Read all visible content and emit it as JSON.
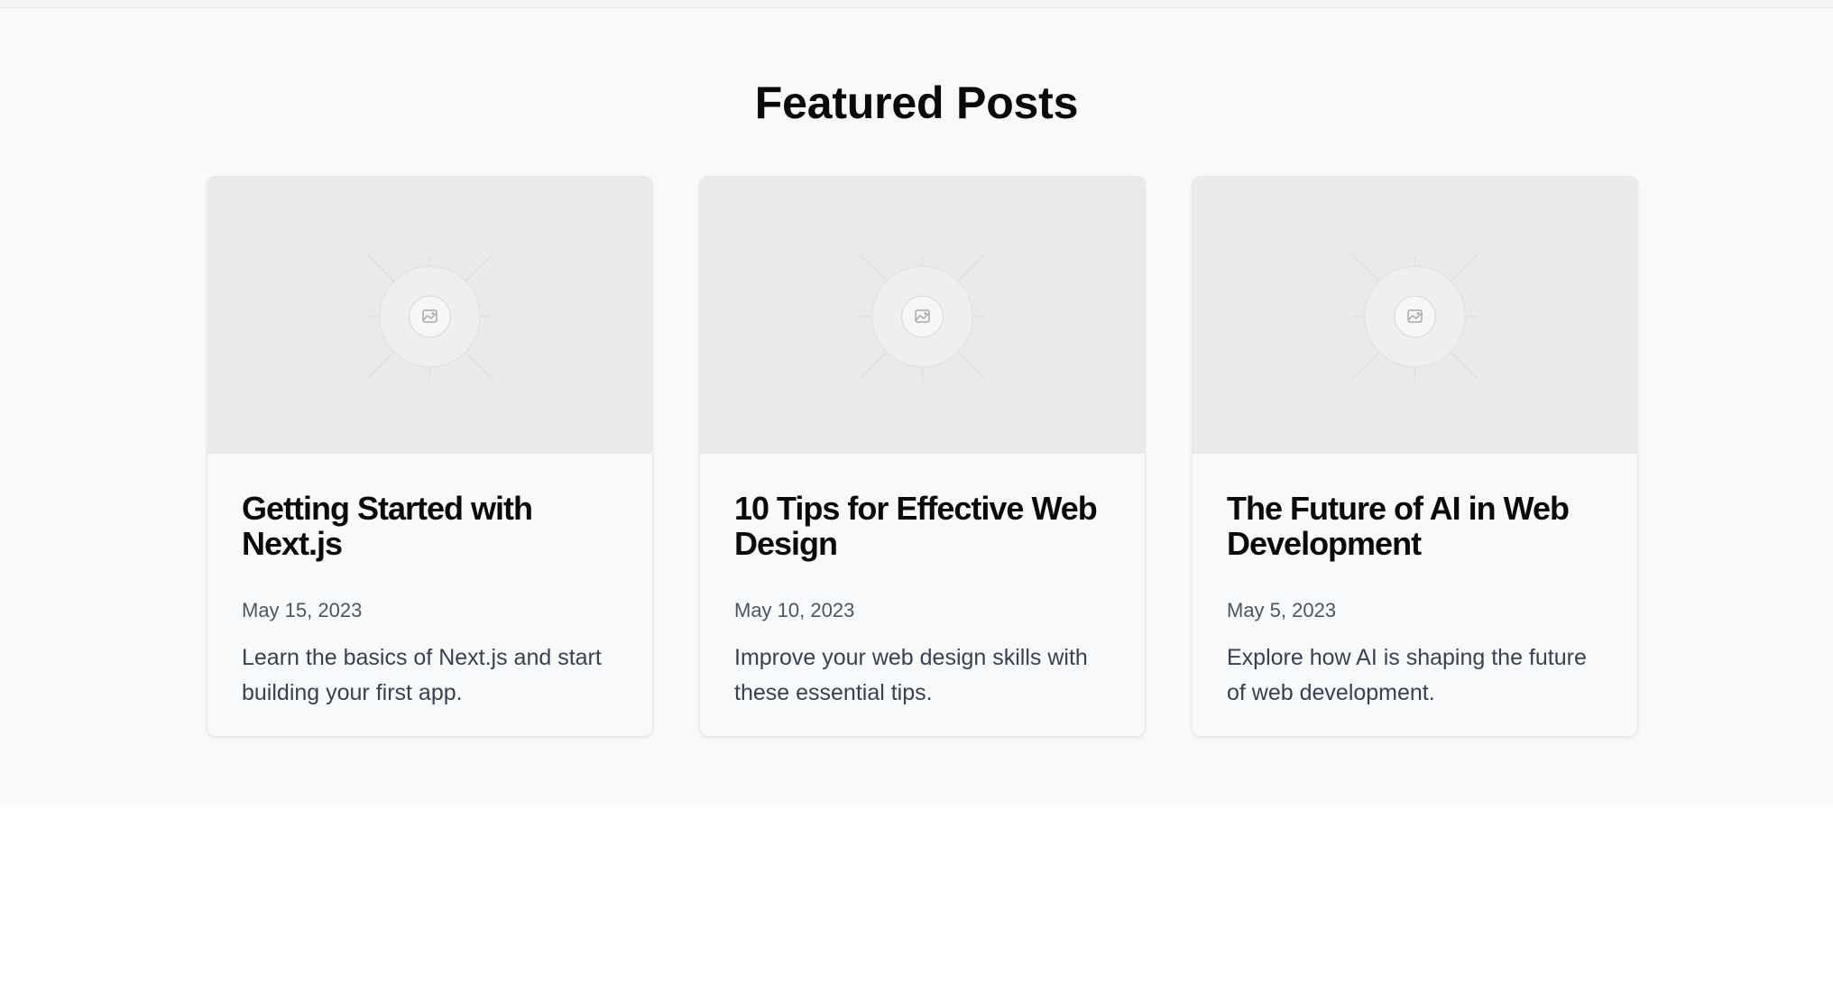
{
  "featured": {
    "title": "Featured Posts",
    "posts": [
      {
        "title": "Getting Started with Next.js",
        "date": "May 15, 2023",
        "excerpt": "Learn the basics of Next.js and start building your first app.",
        "image_icon": "image-placeholder-icon"
      },
      {
        "title": "10 Tips for Effective Web Design",
        "date": "May 10, 2023",
        "excerpt": "Improve your web design skills with these essential tips.",
        "image_icon": "image-placeholder-icon"
      },
      {
        "title": "The Future of AI in Web Development",
        "date": "May 5, 2023",
        "excerpt": "Explore how AI is shaping the future of web development.",
        "image_icon": "image-placeholder-icon"
      }
    ]
  },
  "colors": {
    "section_bg": "#f8f9fa",
    "thumbnail_bg": "#eaeaea",
    "title": "#0a0a0a",
    "date": "#4b5563",
    "excerpt": "#374151"
  }
}
